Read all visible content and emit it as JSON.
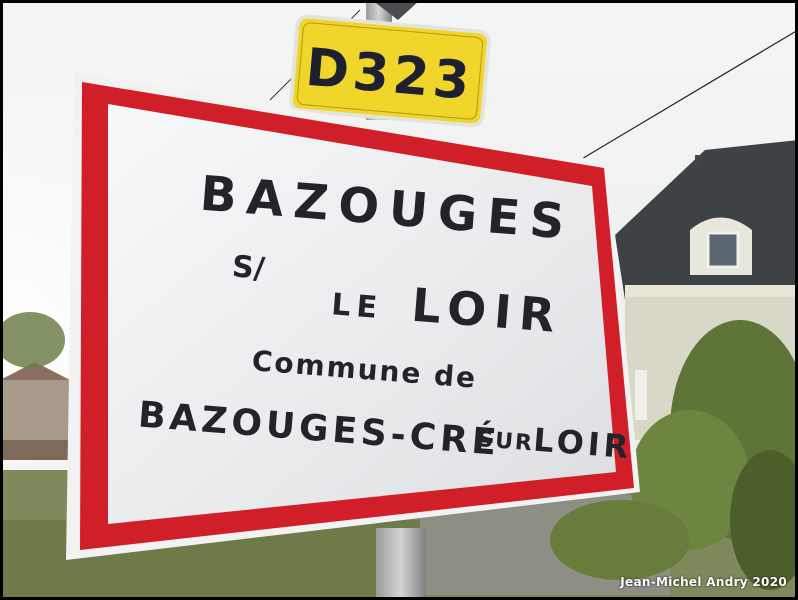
{
  "route_plate": {
    "text": "D323"
  },
  "sign": {
    "line1": "BAZOUGES",
    "line2_prefix": "S/",
    "line2_le": "LE",
    "line2_loir": "LOIR",
    "commune_label": "Commune de",
    "commune_name": "BAZOUGES-CRÉ",
    "commune_sur": "SUR",
    "commune_loir": "LOIR"
  },
  "watermark": {
    "text": "Jean-Michel Andry 2020"
  },
  "colors": {
    "sign_border": "#d11f2a",
    "sign_face": "#eeeff1",
    "plate_yellow": "#f0d52a",
    "roof": "#3d4246",
    "wall": "#d9d8c8"
  }
}
